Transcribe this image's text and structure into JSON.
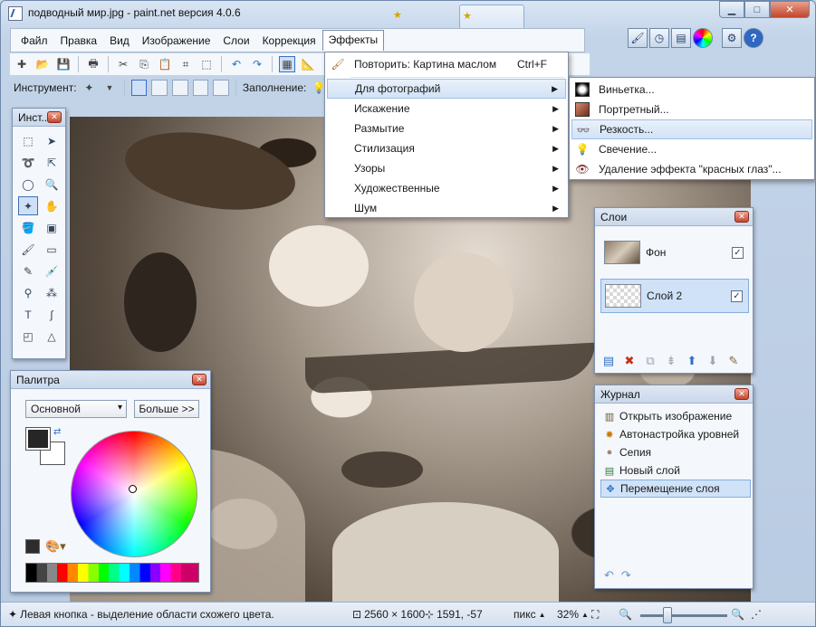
{
  "window": {
    "title": "подводный мир.jpg - paint.net версия 4.0.6"
  },
  "menubar": {
    "items": [
      "Файл",
      "Правка",
      "Вид",
      "Изображение",
      "Слои",
      "Коррекция",
      "Эффекты"
    ]
  },
  "toolbar2": {
    "tool_label": "Инструмент:",
    "fill_label": "Заполнение:"
  },
  "tools_panel": {
    "title": "Инст..."
  },
  "palette_panel": {
    "title": "Палитра",
    "mode": "Основной",
    "more_button": "Больше >>"
  },
  "layers_panel": {
    "title": "Слои",
    "layers": [
      {
        "name": "Фон",
        "visible": "✓"
      },
      {
        "name": "Слой 2",
        "visible": "✓"
      }
    ]
  },
  "history_panel": {
    "title": "Журнал",
    "items": [
      "Открыть изображение",
      "Автонастройка уровней",
      "Сепия",
      "Новый слой",
      "Перемещение слоя"
    ]
  },
  "effects_menu": {
    "repeat": {
      "label": "Повторить: Картина маслом",
      "shortcut": "Ctrl+F"
    },
    "items": [
      "Для фотографий",
      "Искажение",
      "Размытие",
      "Стилизация",
      "Узоры",
      "Художественные",
      "Шум"
    ]
  },
  "photo_submenu": {
    "items": [
      "Виньетка...",
      "Портретный...",
      "Резкость...",
      "Свечение...",
      "Удаление эффекта \"красных глаз\"..."
    ]
  },
  "statusbar": {
    "hint": "Левая кнопка - выделение области схожего цвета.",
    "image_size": "2560 × 1600",
    "cursor_pos": "1591, -57",
    "units": "пикс",
    "zoom": "32%"
  },
  "colors": {
    "accent": "#3970c4",
    "highlight": "#cfe2f7",
    "close": "#c54830"
  }
}
